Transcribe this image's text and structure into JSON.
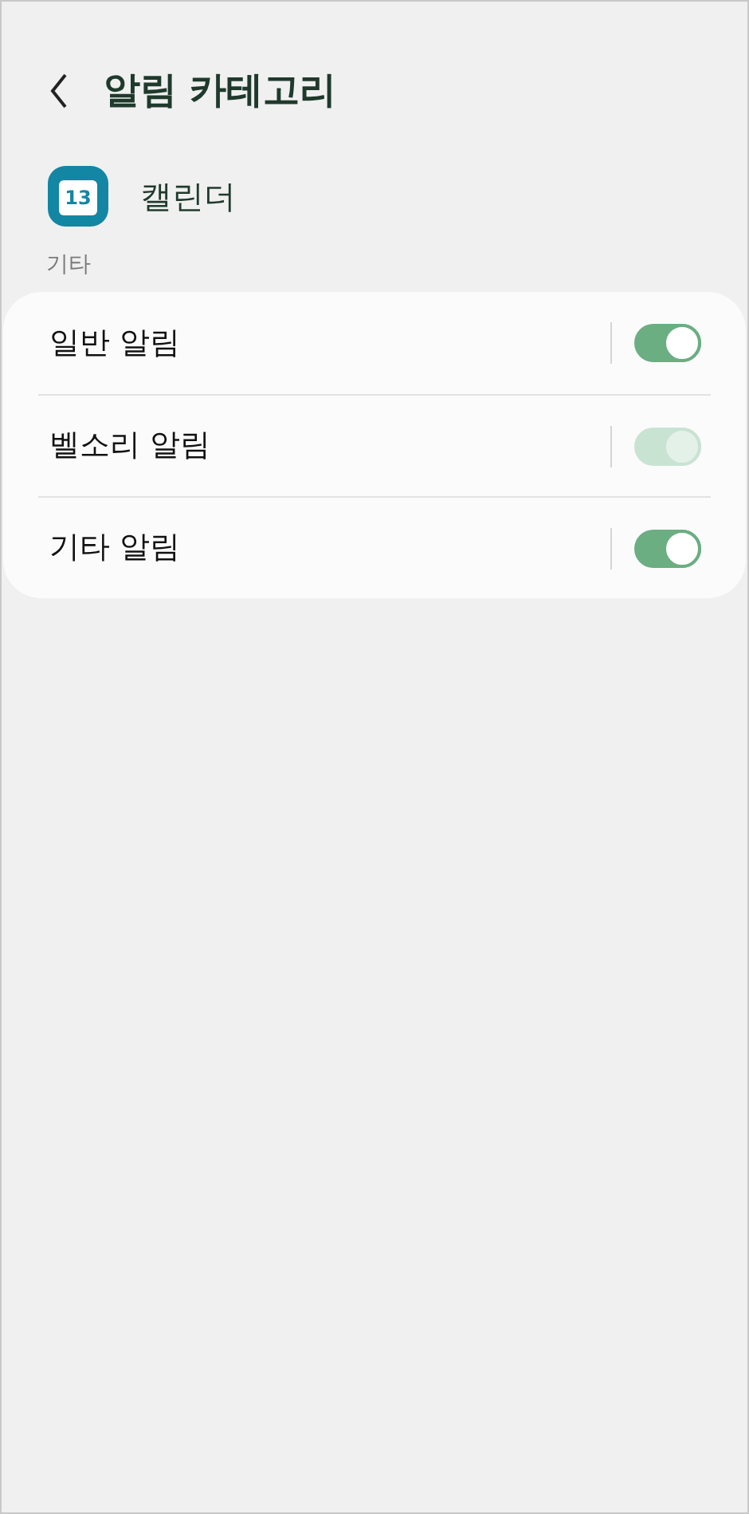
{
  "header": {
    "title": "알림 카테고리"
  },
  "app": {
    "name": "캘린더",
    "icon_text": "13"
  },
  "section": {
    "label": "기타"
  },
  "items": [
    {
      "label": "일반 알림",
      "on": true,
      "disabled": false
    },
    {
      "label": "벨소리 알림",
      "on": true,
      "disabled": true
    },
    {
      "label": "기타 알림",
      "on": true,
      "disabled": false
    }
  ]
}
